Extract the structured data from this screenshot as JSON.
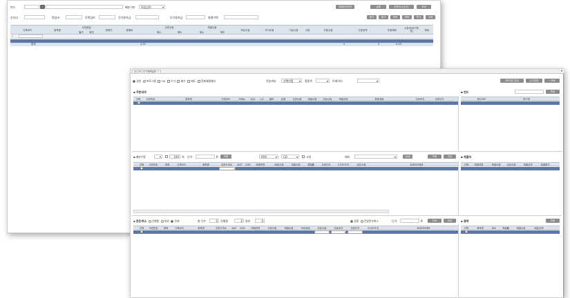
{
  "w1": {
    "fund_label": "펀드",
    "dist_label": "배분구분",
    "dist_value": "직접입력",
    "summary": [
      "순자산",
      "편입비",
      "투편입비",
      "전가용자금",
      "투가용자금",
      "총평가액"
    ],
    "top_buttons": [
      "작업버전관리",
      "실행",
      "주문지시(신규)",
      "조회"
    ],
    "row2_buttons": [
      "종가",
      "종가",
      "위탁",
      "위탁",
      "투가",
      "삭제"
    ],
    "headers": {
      "code": "단축코드",
      "name": "종목명",
      "prev": "사전점검",
      "prev_sub1": "불가",
      "prev_sub2": "위반",
      "cur": "현재가",
      "total": "총해비",
      "order": "주문수량",
      "order_buy": "매수",
      "order_sell": "매도",
      "exec": "체결수량",
      "exec_buy": "매수",
      "exec_sell": "매도",
      "hold": "보유수량",
      "add": "추가수량",
      "base": "기능수량",
      "fix": "고정",
      "oq": "주문수량",
      "amt": "주문금액",
      "ratio": "투총해비",
      "mkt": "시장비(장기목표)",
      "memo": "제외"
    },
    "total_label": "합계",
    "total_a": "0.00",
    "total_b": "0",
    "total_c": "0",
    "total_d": "0.00"
  },
  "w2": {
    "tab": "[4120] 주식매매설정",
    "opts": [
      "일반",
      "프로그램",
      "FIX",
      "수기",
      "매수",
      "매도",
      "전체체결제외"
    ],
    "send_label": "전송여부",
    "send_value": "선택안함",
    "acct_label": "종종목",
    "trader_label": "트레이더",
    "top_buttons": [
      "MP주문 안내",
      "수기전환",
      "조회"
    ],
    "order_sec": "주문내역",
    "order_headers": [
      "선택",
      "주문번호",
      "종목명",
      "단축코드",
      "거래소",
      "B/S",
      "L/S",
      "블럭",
      "유형",
      "주문수량",
      "체결수량",
      "전송수량",
      "체결금액",
      "응용계정",
      "주문조건",
      "주문단가"
    ],
    "fund_sec": "펀드",
    "fund_query": "조회",
    "fund_headers": [
      "펀드코드",
      "펀드명"
    ],
    "alloc_label": "배분수량",
    "pct": "100",
    "pct_unit": "%",
    "price_label": "단가",
    "b_label": "B",
    "apply": "적용",
    "exch": "KRX",
    "cd": "CD",
    "fixed": "고정",
    "memo": "메모",
    "detail": "상세",
    "query": "조회",
    "send": "전송",
    "alloc_headers": [
      "선택",
      "주문번호",
      "매체",
      "단축코드",
      "종목명",
      "주문가격소",
      "NXT",
      "SOR",
      "매매처면",
      "배분수량",
      "체결수량",
      "체결률",
      "주문단가",
      "STOP가격",
      "남은수량",
      "트레이더메모"
    ],
    "exec_sec": "체결처",
    "exec_headers": [
      "선택",
      "체결처명",
      "체결수량",
      "전송수량",
      "체결금액",
      "체결평가"
    ],
    "status_sec": "정정/취소",
    "status_opts": [
      "진행중",
      "완료",
      "전체"
    ],
    "total_cnt": "총 건수",
    "total_cnt_val": "0",
    "progress": "진행중",
    "progress_val": "0",
    "done": "완료",
    "done_val": "0",
    "r_opts": [
      "정정",
      "전량전부취소"
    ],
    "r_price": "단가",
    "r_b": "B",
    "r_query": "조회",
    "r_send": "전송",
    "status_headers": [
      "선택",
      "주문번호",
      "매체",
      "단축코드",
      "종목명",
      "주문가격소",
      "NXT",
      "SOR",
      "매매처면",
      "주문수량",
      "체결수량",
      "처리상태",
      "전송수량",
      "전송조건",
      "전송단가",
      "STOP가격",
      "트레이더메모"
    ],
    "stock_sec": "종목",
    "stock_query": "조회",
    "stock_headers": [
      "선택",
      "종목명",
      "B/S",
      "체결률",
      "체결수량",
      "배분금액"
    ]
  }
}
